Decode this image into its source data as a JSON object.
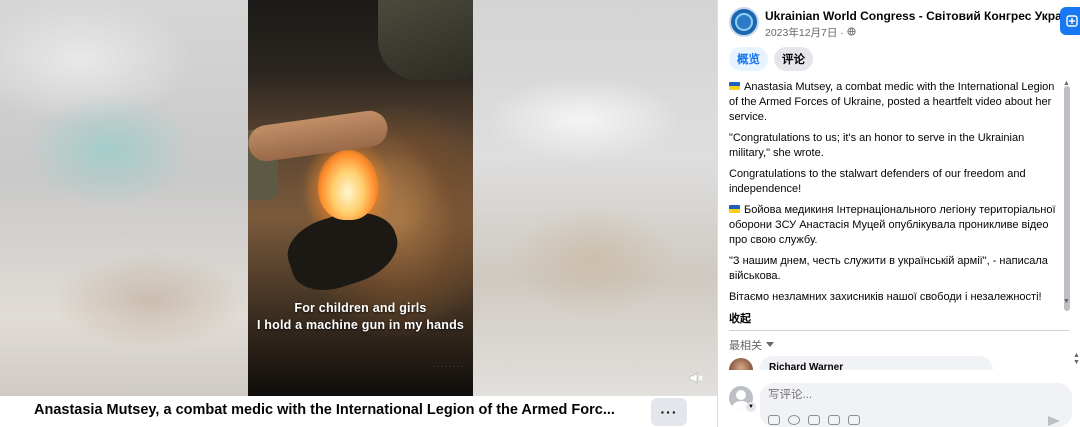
{
  "video": {
    "subtitle_line1": "For children and girls",
    "subtitle_line2": "I hold a machine gun in my hands",
    "title": "Anastasia Mutsey, a combat medic with the International Legion of the Armed Forc...",
    "more_label": "···",
    "mute_icon": "speaker-muted-icon"
  },
  "post": {
    "page_name": "Ukrainian World Congress - Світовий Конгрес Українців",
    "date": "2023年12月7日 ·",
    "audience_icon": "globe-icon",
    "follow_icon": "add-friend-icon",
    "tabs": [
      {
        "label": "概览",
        "active": true
      },
      {
        "label": "评论",
        "active": false
      }
    ],
    "paragraphs": [
      {
        "flag": true,
        "text": "Anastasia Mutsey, a combat medic with the International Legion of the Armed Forces of Ukraine, posted a heartfelt video about her service."
      },
      {
        "flag": false,
        "text": "\"Congratulations to us; it's an honor to serve in the Ukrainian military,\" she wrote."
      },
      {
        "flag": false,
        "text": "Congratulations to the stalwart defenders of our freedom and independence!"
      },
      {
        "flag": true,
        "text": "Бойова медикиня Інтернаціонального легіону територіальної оборони ЗСУ Анастасія Муцей опублікувала проникливе відео про свою службу."
      },
      {
        "flag": false,
        "text": "\"З нашим днем, честь служити в українській армії\", - написала військова."
      },
      {
        "flag": false,
        "text": "Вітаємо незламних захисників нашої свободи і незалежності!"
      }
    ],
    "collapse_label": "收起",
    "sort_label": "最相关",
    "first_comment_author": "Richard Warner"
  },
  "composer": {
    "placeholder": "写评论..."
  },
  "colors": {
    "accent": "#1877f2",
    "tab_active_bg": "#e7f3ff",
    "secondary_text": "#65676b"
  }
}
